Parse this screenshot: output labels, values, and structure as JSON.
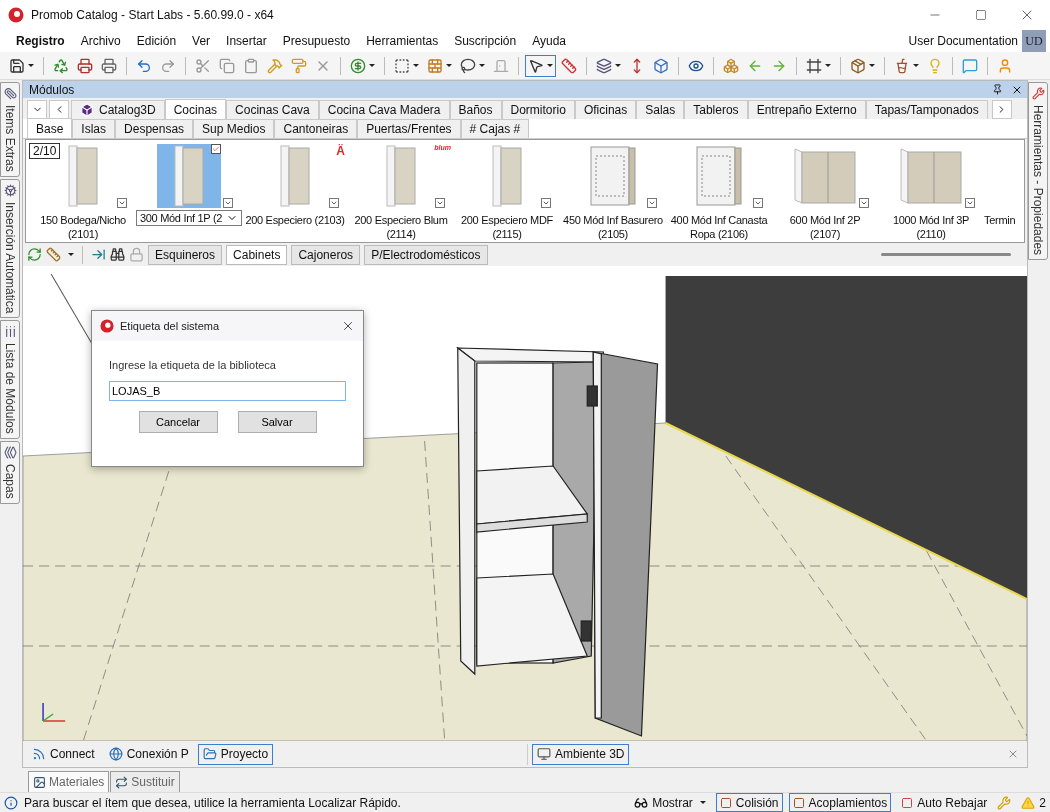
{
  "window": {
    "title": "Promob Catalog - Start Labs - 5.60.99.0 - x64"
  },
  "menu": [
    {
      "label": "Registro",
      "selected": true
    },
    {
      "label": "Archivo",
      "selected": false
    },
    {
      "label": "Edición",
      "selected": false
    },
    {
      "label": "Ver",
      "selected": false
    },
    {
      "label": "Insertar",
      "selected": false
    },
    {
      "label": "Presupuesto",
      "selected": false
    },
    {
      "label": "Herramientas",
      "selected": false
    },
    {
      "label": "Suscripción",
      "selected": false
    },
    {
      "label": "Ayuda",
      "selected": false
    }
  ],
  "user": {
    "name": "User Documentation",
    "initials": "UD"
  },
  "left_tabs": [
    {
      "label": "Items Extras",
      "kind": "clip"
    },
    {
      "label": "Inserción Automática",
      "kind": "gears"
    },
    {
      "label": "Lista de Módulos",
      "kind": "list"
    },
    {
      "label": "Capas",
      "kind": "layers"
    }
  ],
  "right_tabs": [
    {
      "label": "Herramientas - Propiedades",
      "kind": "tools"
    }
  ],
  "modules": {
    "title": "Módulos",
    "tabs": [
      {
        "label": "Catalog3D",
        "selected": false
      },
      {
        "label": "Cocinas",
        "selected": true
      },
      {
        "label": "Cocinas Cava",
        "selected": false
      },
      {
        "label": "Cocina Cava Madera",
        "selected": false
      },
      {
        "label": "Baños",
        "selected": false
      },
      {
        "label": "Dormitorio",
        "selected": false
      },
      {
        "label": "Oficinas",
        "selected": false
      },
      {
        "label": "Salas",
        "selected": false
      },
      {
        "label": "Tableros",
        "selected": false
      },
      {
        "label": "Entrepaño Externo",
        "selected": false
      },
      {
        "label": "Tapas/Tamponados",
        "selected": false
      }
    ],
    "subtabs": [
      {
        "label": "Base",
        "selected": true
      },
      {
        "label": "Islas",
        "selected": false
      },
      {
        "label": "Despensas",
        "selected": false
      },
      {
        "label": "Sup Medios",
        "selected": false
      },
      {
        "label": "Cantoneiras",
        "selected": false
      },
      {
        "label": "Puertas/Frentes",
        "selected": false
      },
      {
        "label": "# Cajas #",
        "selected": false
      }
    ],
    "page": "2/10",
    "items": [
      {
        "label": [
          "150 Bodega/Nicho",
          "(2101)"
        ],
        "kind": "narrow",
        "selected": false
      },
      {
        "label": [
          "300 Mód Inf 1P (2"
        ],
        "kind": "narrow",
        "selected": true
      },
      {
        "label": [
          "200 Especiero (2103)"
        ],
        "kind": "narrow",
        "selected": false,
        "logo": "Ä"
      },
      {
        "label": [
          "200 Especiero Blum",
          "(2114)"
        ],
        "kind": "narrow",
        "selected": false,
        "logo": "blum"
      },
      {
        "label": [
          "200 Especiero MDF",
          "(2115)"
        ],
        "kind": "narrow",
        "selected": false
      },
      {
        "label": [
          "450 Mód Inf Basurero",
          "(2105)"
        ],
        "kind": "open",
        "selected": false
      },
      {
        "label": [
          "400 Mód Inf Canasta",
          "Ropa (2106)"
        ],
        "kind": "open",
        "selected": false
      },
      {
        "label": [
          "600 Mód Inf 2P",
          "(2107)"
        ],
        "kind": "wide",
        "selected": false
      },
      {
        "label": [
          "1000 Mód Inf 3P",
          "(2110)"
        ],
        "kind": "wide",
        "selected": false
      },
      {
        "label": [
          "Termin"
        ],
        "kind": "blank",
        "selected": false
      }
    ],
    "categories": [
      {
        "label": "Esquineros",
        "selected": false
      },
      {
        "label": "Cabinets",
        "selected": true
      },
      {
        "label": "Cajoneros",
        "selected": false
      },
      {
        "label": "P/Electrodomésticos",
        "selected": false
      }
    ]
  },
  "dialog": {
    "title": "Etiqueta del sistema",
    "prompt": "Ingrese la etiqueta de la biblioteca",
    "value": "LOJAS_B",
    "buttons": [
      "Cancelar",
      "Salvar"
    ]
  },
  "document_tabs": {
    "left": [
      {
        "label": "Connect",
        "kind": "rss",
        "selected": false
      },
      {
        "label": "Conexión P",
        "kind": "globe",
        "selected": false
      },
      {
        "label": "Proyecto",
        "kind": "folder",
        "selected": true
      }
    ],
    "right": [
      {
        "label": "Ambiente 3D",
        "kind": "scene",
        "selected": true
      }
    ]
  },
  "bottom_tabs": [
    {
      "label": "Materiales",
      "kind": "materials",
      "selected": true
    },
    {
      "label": "Sustituir",
      "kind": "swap",
      "selected": false
    }
  ],
  "status_bar": {
    "message": "Para buscar el ítem que desea, utilice la herramienta Localizar Rápido.",
    "items": [
      {
        "label": "Mostrar",
        "kind": "dropdown",
        "on": false
      },
      {
        "label": "Colisión",
        "kind": "toggle",
        "on": true
      },
      {
        "label": "Acoplamientos",
        "kind": "toggle",
        "on": true
      },
      {
        "label": "Auto Rebajar",
        "kind": "toggle",
        "on": false
      }
    ],
    "warnings": "2"
  }
}
